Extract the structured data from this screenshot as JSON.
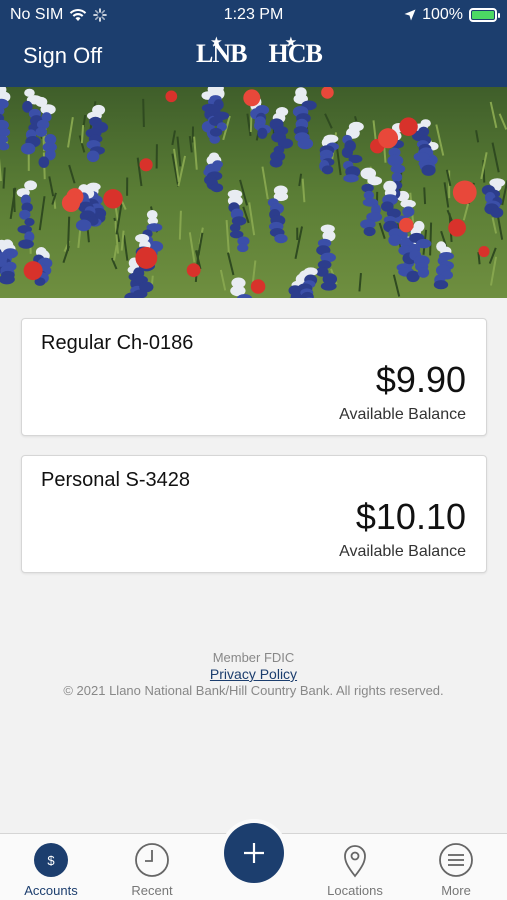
{
  "status_bar": {
    "carrier": "No SIM",
    "time": "1:23 PM",
    "battery": "100%",
    "battery_level": 1.0
  },
  "header": {
    "sign_off_label": "Sign Off",
    "logo_left": "LNB",
    "logo_right": "HCB",
    "color": "#1c3e6e"
  },
  "hero": {
    "icon": "bluebonnet-wildflowers-photo"
  },
  "accounts": [
    {
      "name": "Regular Ch-0186",
      "balance": "$9.90",
      "balance_label": "Available Balance"
    },
    {
      "name": "Personal S-3428",
      "balance": "$10.10",
      "balance_label": "Available Balance"
    }
  ],
  "footer": {
    "member": "Member FDIC",
    "privacy_link": "Privacy Policy",
    "copyright": "© 2021 Llano National Bank/Hill Country Bank. All rights reserved."
  },
  "tab_bar": {
    "tabs": [
      {
        "label": "Accounts",
        "icon": "dollar-circle-icon",
        "active": true
      },
      {
        "label": "Recent",
        "icon": "clock-icon",
        "active": false
      },
      {
        "label": "Locations",
        "icon": "location-pin-icon",
        "active": false
      },
      {
        "label": "More",
        "icon": "menu-icon",
        "active": false
      }
    ],
    "fab_icon": "plus-icon",
    "active_color": "#1c3e6e"
  }
}
